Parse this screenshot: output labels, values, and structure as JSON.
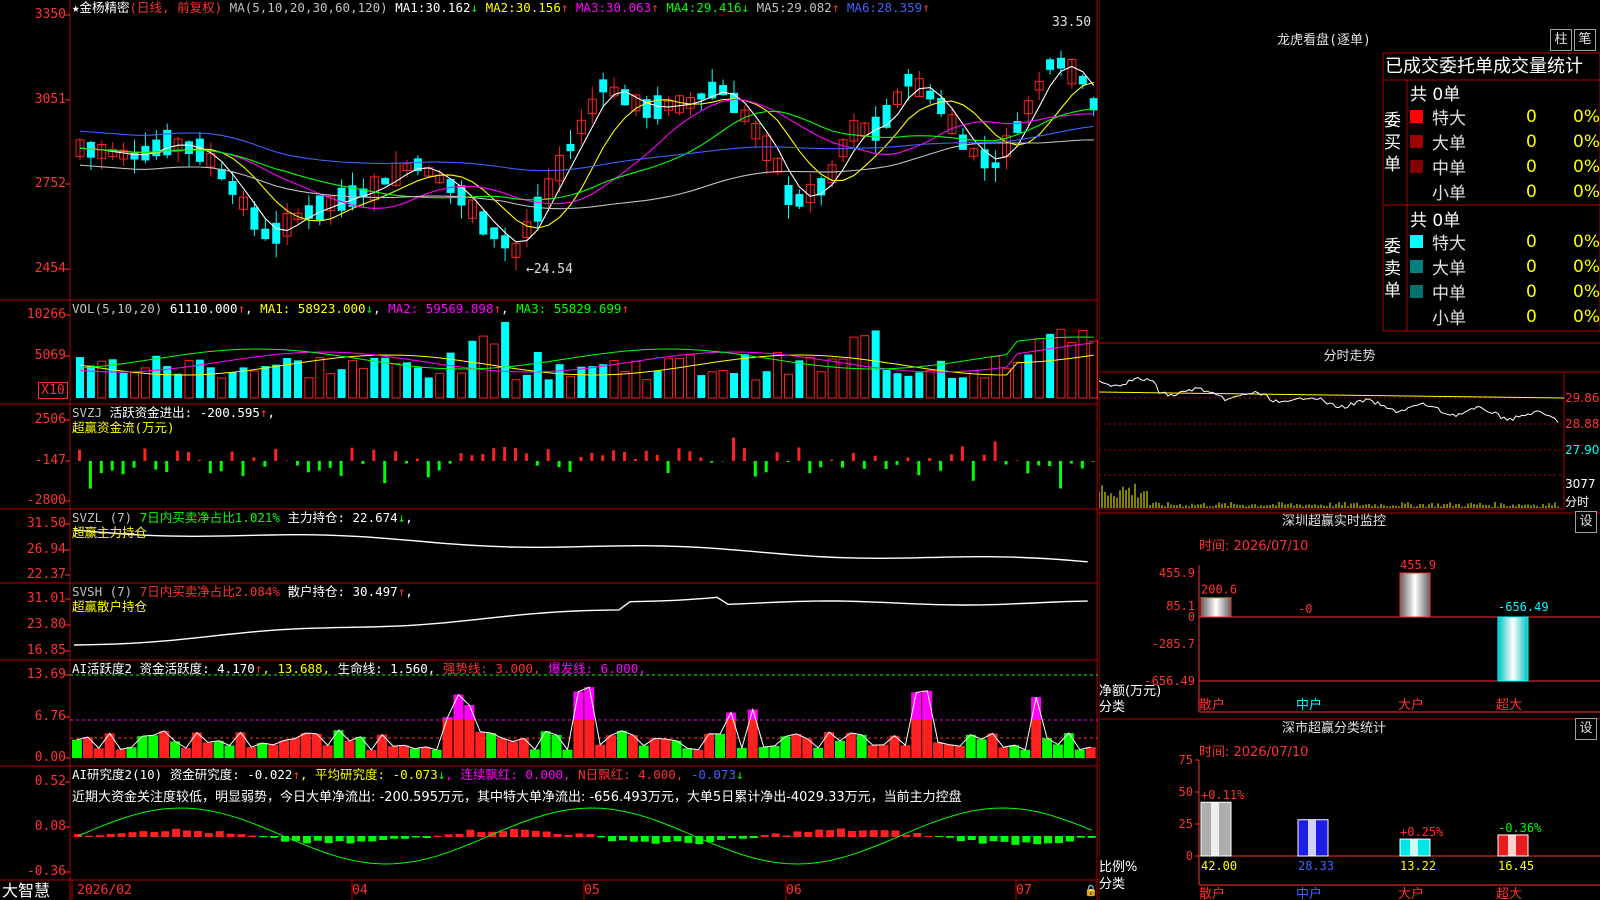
{
  "app": {
    "logo": "大智慧"
  },
  "colors": {
    "up": "#ff2020",
    "down": "#00ffff",
    "ma1": "#ffffff",
    "ma2": "#ffff00",
    "ma3": "#ff00ff",
    "ma4": "#00ff00",
    "ma5": "#c0c0c0",
    "ma6": "#4040ff",
    "grid": "#aa0000"
  },
  "kline": {
    "symbol": "★金杨精密",
    "mode": "(日线, 前复权)",
    "ma_label": "MA(5,10,20,30,60,120)",
    "ma": [
      {
        "name": "MA1:",
        "value": "30.162",
        "arrow": "↓"
      },
      {
        "name": "MA2:",
        "value": "30.156",
        "arrow": "↑"
      },
      {
        "name": "MA3:",
        "value": "30.063",
        "arrow": "↑"
      },
      {
        "name": "MA4:",
        "value": "29.416",
        "arrow": "↓"
      },
      {
        "name": "MA5:",
        "value": "29.082",
        "arrow": "↑"
      },
      {
        "name": "MA6:",
        "value": "28.359",
        "arrow": "↑"
      }
    ],
    "y_ticks": [
      "3350",
      "3051",
      "2752",
      "2454"
    ],
    "high_marker": "33.50",
    "low_marker": "←24.54"
  },
  "vol": {
    "label": "VOL(5,10,20)",
    "value": "61110.000",
    "arrow": "↑",
    "ma1": "MA1: 58923.000",
    "ma1_arrow": "↓",
    "ma2": "MA2: 59569.898",
    "ma2_arrow": "↑",
    "ma3": "MA3: 55829.699",
    "ma3_arrow": "↑",
    "y_ticks": [
      "10266",
      "5069"
    ],
    "unit": "X10"
  },
  "svzj": {
    "label": "SVZJ",
    "text": "活跃资金进出: -200.595",
    "arrow": "↑",
    "comma": ",",
    "sub": "超赢资金流(万元)",
    "y_ticks": [
      "2506",
      "-147",
      "-2800"
    ]
  },
  "svzl": {
    "label": "SVZL (7)",
    "text1": "7日内买卖净占比1.021%",
    "text2": "主力持仓: 22.674",
    "arrow": "↓",
    "comma": ",",
    "sub": "超赢主力持仓",
    "y_ticks": [
      "31.50",
      "26.94",
      "22.37"
    ]
  },
  "svsh": {
    "label": "SVSH (7)",
    "text1": "7日内买卖净占比2.084%",
    "text2": "散户持仓: 30.497",
    "arrow": "↑",
    "comma": ",",
    "sub": "超赢散户持仓",
    "y_ticks": [
      "31.01",
      "23.80",
      "16.85"
    ]
  },
  "ai1": {
    "label": "AI活跃度2",
    "text1": "资金活跃度: 4.170",
    "a1": "↑",
    "text2": ", 13.688,",
    "text3": "生命线: 1.560,",
    "text4": "强势线: 3.000,",
    "text5": "爆发线: 6.000,",
    "y_ticks": [
      "13.69",
      "6.76",
      "0.00"
    ]
  },
  "ai2": {
    "label": "AI研究度2(10)",
    "text1": "资金研究度: -0.022",
    "a1": "↑",
    "text2": ", 平均研究度: -0.073",
    "a2": "↓",
    "text3": ", 连续飘红: 0.000,",
    "text4": "N日飘红: 4.000,",
    "text5": "-0.073",
    "a5": "↓",
    "comment": "近期大资金关注度较低，明显弱势，今日大单净流出: -200.595万元，其中特大单净流出: -656.493万元，大单5日累计净出-4029.33万元，当前主力控盘",
    "y_ticks": [
      "0.52",
      "0.08",
      "-0.36"
    ]
  },
  "xaxis": [
    "2026/02",
    "04",
    "05",
    "06",
    "07"
  ],
  "lhb": {
    "title": "龙虎看盘(逐单)",
    "btn1": "柱",
    "btn2": "笔",
    "tabs": "已成交委托单成交量统计",
    "buy_label": "委买单",
    "sell_label": "委卖单",
    "total": "共 0单",
    "rows": [
      {
        "name": "特大",
        "v": "0",
        "p": "0%"
      },
      {
        "name": "大单",
        "v": "0",
        "p": "0%"
      },
      {
        "name": "中单",
        "v": "0",
        "p": "0%"
      },
      {
        "name": "小单",
        "v": "0",
        "p": "0%"
      }
    ]
  },
  "fenshi": {
    "title": "分时走势",
    "y": [
      "29.86",
      "28.88",
      "27.90"
    ],
    "vol": "3077",
    "vol_unit": "分时"
  },
  "szmonitor": {
    "title": "深圳超赢实时监控",
    "btn": "设",
    "time": "时间: 2026/07/10",
    "ylabels": [
      "455.9",
      "85.1",
      "0",
      "-285.7",
      "-656.49"
    ],
    "unit": "净额(万元)",
    "cat_label": "分类",
    "cats": [
      "散户",
      "中户",
      "大户",
      "超大"
    ],
    "values": [
      200.6,
      0,
      455.9,
      -656.49
    ],
    "value_labels": [
      "200.6",
      "-0",
      "455.9",
      "-656.49"
    ]
  },
  "szclass": {
    "title": "深市超赢分类统计",
    "btn": "设",
    "time": "时间: 2026/07/10",
    "ylabels": [
      "75",
      "50",
      "25",
      "0"
    ],
    "unit": "比例%",
    "cat_label": "分类",
    "cats": [
      "散户",
      "中户",
      "大户",
      "超大"
    ],
    "values": [
      42.0,
      28.33,
      13.22,
      16.45
    ],
    "value_labels": [
      "42.00",
      "28.33",
      "13.22",
      "16.45"
    ],
    "delta": [
      "+0.11%",
      "",
      "+0.25%",
      "-0.36%"
    ]
  }
}
